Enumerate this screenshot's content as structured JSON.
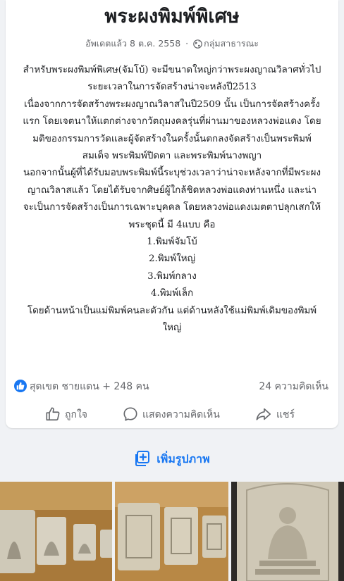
{
  "post": {
    "title": "พระผงพิมพ์พิเศษ",
    "meta_updated": "อัพเดตแล้ว 8 ต.ค. 2558",
    "meta_separator": "·",
    "meta_audience": "กลุ่มสาธารณะ",
    "paragraphs": [
      "สำหรับพระผงพิมพ์พิเศษ(จัมโบ้) จะมีขนาดใหญ่กว่าพระผงญาณวิลาศทั่วไป ระยะเวลาในการจัดสร้างน่าจะหลังปี2513",
      "เนื่องจากการจัดสร้างพระผงญาณวิลาสในปี2509 นั้น เป็นการจัดสร้างครั้งแรก โดยเจตนาให้แตกต่างจากวัตถุมงคลรุ่นที่ผ่านมาของหลวงพ่อแดง โดยมติของกรรมการวัดและผู้จัดสร้างในครั้งนั้นตกลงจัดสร้างเป็นพระพิมพ์สมเด็จ พระพิมพ์ปิดตา และพระพิมพ์นางพญา",
      "นอกจากนั้นผู้ที่ได้รับมอบพระพิมพ์นี้ระบุช่วงเวลาว่าน่าจะหลังจากที่มีพระผงญาณวิลาสแล้ว โดยได้รับจากศิษย์ผู้ใกล้ชิดหลวงพ่อแดงท่านหนึ่ง และน่าจะเป็นการจัดสร้างเป็นการเฉพาะบุคคล โดยหลวงพ่อแดงเมตตาปลุกเสกให้",
      "พระชุดนี้ มี 4แบบ คือ",
      "1.พิมพ์จัมโบ้",
      "2.พิมพ์ใหญ่",
      "3.พิมพ์กลาง",
      "4.พิมพ์เล็ก",
      "โดยด้านหน้าเป็นแม่พิมพ์คนละตัวกัน แต่ด้านหลังใช้แม่พิมพ์เดิมของพิมพ์ใหญ่"
    ]
  },
  "reactions": {
    "names": "สุดเขต ชายแดน + 248 คน",
    "comments": "24 ความคิดเห็น"
  },
  "actions": {
    "like": "ถูกใจ",
    "comment": "แสดงความคิดเห็น",
    "share": "แชร์"
  },
  "add_photo": {
    "label": "เพิ่มรูปภาพ"
  },
  "colors": {
    "accent": "#1877f2",
    "secondary_text": "#65676b",
    "background": "#f0f2f5"
  },
  "icons": {
    "audience": "globe-icon",
    "reaction": "thumbs-up-icon",
    "like": "thumbs-up-outline-icon",
    "comment": "speech-bubble-icon",
    "share": "share-arrow-icon",
    "add_photo": "add-photo-icon"
  }
}
